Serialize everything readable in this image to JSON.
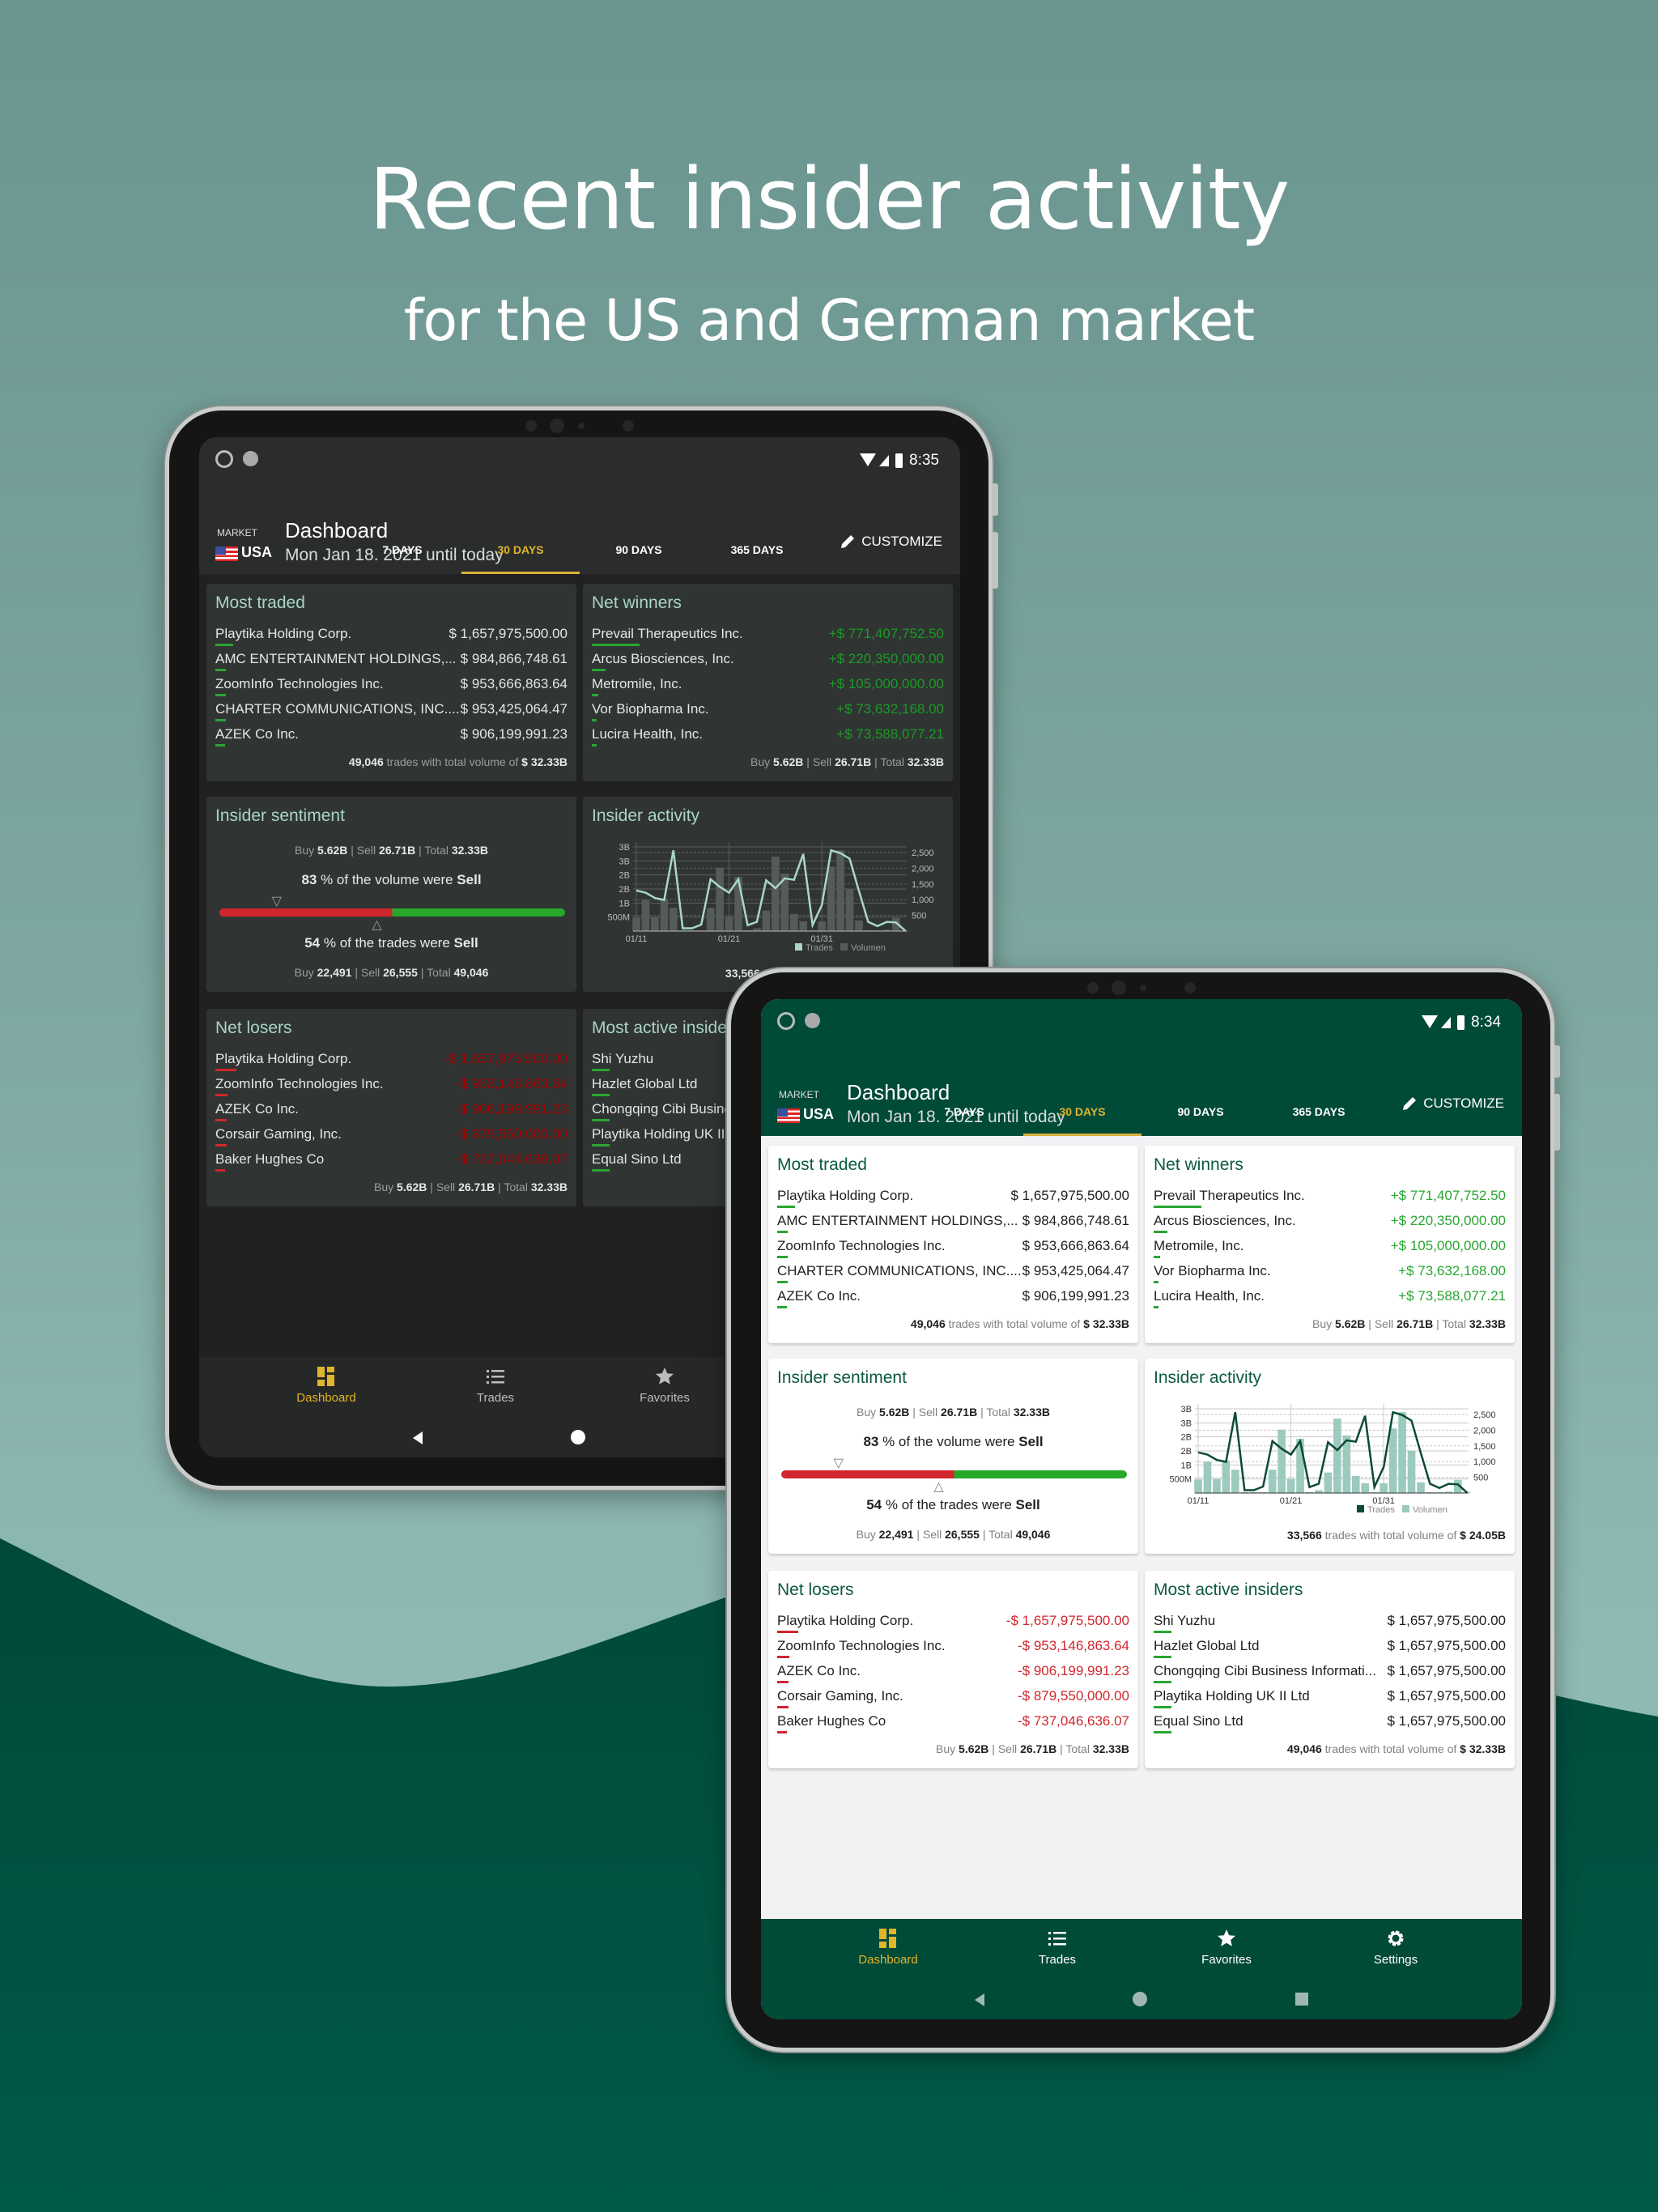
{
  "hero": {
    "title": "Recent insider activity",
    "subtitle": "for the US and German market"
  },
  "colors": {
    "accent_gold": "#e0b52c",
    "brand_green": "#004a38",
    "positive": "#2aa532",
    "negative": "#d0262d",
    "bar_volume": "#9ccabf",
    "line_trades": "#0b4a36"
  },
  "tablets": [
    {
      "theme": "dark",
      "time": "8:35"
    },
    {
      "theme": "light",
      "time": "8:34"
    }
  ],
  "dashboard": {
    "market_label": "MARKET",
    "market": "USA",
    "title": "Dashboard",
    "subtitle": "Mon Jan 18. 2021 until today",
    "customize": "CUSTOMIZE",
    "tabs": [
      {
        "label": "7 DAYS",
        "active": false
      },
      {
        "label": "30 DAYS",
        "active": true
      },
      {
        "label": "90 DAYS",
        "active": false
      },
      {
        "label": "365 DAYS",
        "active": false
      }
    ],
    "most_traded": {
      "title": "Most traded",
      "rows": [
        {
          "name": "Playtika Holding Corp.",
          "value": "$ 1,657,975,500.00"
        },
        {
          "name": "AMC ENTERTAINMENT HOLDINGS,...",
          "value": "$ 984,866,748.61"
        },
        {
          "name": "ZoomInfo Technologies Inc.",
          "value": "$ 953,666,863.64"
        },
        {
          "name": "CHARTER COMMUNICATIONS, INC....",
          "value": "$ 953,425,064.47"
        },
        {
          "name": "AZEK Co Inc.",
          "value": "$ 906,199,991.23"
        }
      ],
      "footer": [
        {
          "t": "49,046",
          "b": true
        },
        {
          "t": " trades with total volume of "
        },
        {
          "t": "$ 32.33B",
          "b": true
        }
      ]
    },
    "net_winners": {
      "title": "Net winners",
      "rows": [
        {
          "name": "Prevail Therapeutics Inc.",
          "value": "+$ 771,407,752.50"
        },
        {
          "name": "Arcus Biosciences, Inc.",
          "value": "+$ 220,350,000.00"
        },
        {
          "name": "Metromile, Inc.",
          "value": "+$ 105,000,000.00"
        },
        {
          "name": "Vor Biopharma Inc.",
          "value": "+$ 73,632,168.00"
        },
        {
          "name": "Lucira Health, Inc.",
          "value": "+$ 73,588,077.21"
        }
      ],
      "footer": [
        {
          "t": "Buy "
        },
        {
          "t": "5.62B",
          "b": true
        },
        {
          "t": " | Sell "
        },
        {
          "t": "26.71B",
          "b": true
        },
        {
          "t": " | Total "
        },
        {
          "t": "32.33B",
          "b": true
        }
      ]
    },
    "insider_sentiment": {
      "title": "Insider sentiment",
      "volume_line": [
        {
          "t": "Buy "
        },
        {
          "t": "5.62B",
          "b": true
        },
        {
          "t": " | Sell "
        },
        {
          "t": "26.71B",
          "b": true
        },
        {
          "t": " | Total "
        },
        {
          "t": "32.33B",
          "b": true
        }
      ],
      "volume_sell_percent": 83,
      "volume_text": [
        {
          "t": "83",
          "b": true
        },
        {
          "t": " % of the volume were "
        },
        {
          "t": "Sell",
          "b": true
        }
      ],
      "trades_sell_percent": 54,
      "trades_text": [
        {
          "t": "54",
          "b": true
        },
        {
          "t": " % of the trades were "
        },
        {
          "t": "Sell",
          "b": true
        }
      ],
      "trades_line": [
        {
          "t": "Buy "
        },
        {
          "t": "22,491",
          "b": true
        },
        {
          "t": " | Sell "
        },
        {
          "t": "26,555",
          "b": true
        },
        {
          "t": " | Total "
        },
        {
          "t": "49,046",
          "b": true
        }
      ]
    },
    "insider_activity": {
      "title": "Insider activity",
      "footer": [
        {
          "t": "33,566",
          "b": true
        },
        {
          "t": " trades with total volume of "
        },
        {
          "t": "$ 24.05B",
          "b": true
        }
      ]
    },
    "net_losers": {
      "title": "Net losers",
      "rows": [
        {
          "name": "Playtika Holding Corp.",
          "value": "-$ 1,657,975,500.00"
        },
        {
          "name": "ZoomInfo Technologies Inc.",
          "value": "-$ 953,146,863.64"
        },
        {
          "name": "AZEK Co Inc.",
          "value": "-$ 906,199,991.23"
        },
        {
          "name": "Corsair Gaming, Inc.",
          "value": "-$ 879,550,000.00"
        },
        {
          "name": "Baker Hughes Co",
          "value": "-$ 737,046,636.07"
        }
      ],
      "footer": [
        {
          "t": "Buy "
        },
        {
          "t": "5.62B",
          "b": true
        },
        {
          "t": " | Sell "
        },
        {
          "t": "26.71B",
          "b": true
        },
        {
          "t": " | Total "
        },
        {
          "t": "32.33B",
          "b": true
        }
      ]
    },
    "most_active_insiders": {
      "title": "Most active insiders",
      "rows": [
        {
          "name": "Shi Yuzhu",
          "value": "$ 1,657,975,500.00"
        },
        {
          "name": "Hazlet Global Ltd",
          "value": "$ 1,657,975,500.00"
        },
        {
          "name": "Chongqing Cibi Business Informati...",
          "value": "$ 1,657,975,500.00"
        },
        {
          "name": "Playtika Holding UK II Ltd",
          "value": "$ 1,657,975,500.00"
        },
        {
          "name": "Equal Sino Ltd",
          "value": "$ 1,657,975,500.00"
        }
      ],
      "footer": [
        {
          "t": "49,046",
          "b": true
        },
        {
          "t": " trades with total volume of "
        },
        {
          "t": "$ 32.33B",
          "b": true
        }
      ]
    },
    "nav": [
      {
        "label": "Dashboard",
        "icon": "dashboard-icon",
        "active": true
      },
      {
        "label": "Trades",
        "icon": "list-icon",
        "active": false
      },
      {
        "label": "Favorites",
        "icon": "star-icon",
        "active": false
      },
      {
        "label": "Settings",
        "icon": "gear-icon",
        "active": false
      }
    ]
  },
  "chart_data": {
    "type": "bar-line",
    "x": [
      "01/11",
      "01/12",
      "01/13",
      "01/14",
      "01/15",
      "01/16",
      "01/17",
      "01/18",
      "01/19",
      "01/20",
      "01/21",
      "01/22",
      "01/23",
      "01/24",
      "01/25",
      "01/26",
      "01/27",
      "01/28",
      "01/29",
      "01/30",
      "01/31",
      "02/01",
      "02/02",
      "02/03",
      "02/04",
      "02/05",
      "02/06",
      "02/07",
      "02/08",
      "02/09"
    ],
    "x_tick_labels": [
      "01/11",
      "01/21",
      "01/31"
    ],
    "series": [
      {
        "name": "Volumen",
        "type": "bar",
        "axis": "left",
        "values": [
          0.48,
          1.12,
          0.5,
          1.16,
          0.83,
          0.03,
          0.03,
          0.03,
          0.83,
          2.26,
          0.5,
          1.93,
          0.03,
          0.1,
          0.73,
          2.65,
          2.05,
          0.61,
          0.35,
          0.03,
          0.35,
          2.3,
          2.88,
          1.51,
          0.38,
          0.03,
          0.03,
          0.05,
          0.47,
          0.02
        ]
      },
      {
        "name": "Trades",
        "type": "line",
        "axis": "right",
        "values": [
          1295,
          1223,
          1054,
          991,
          2571,
          89,
          89,
          205,
          1652,
          1411,
          1223,
          1652,
          188,
          295,
          1616,
          1366,
          1679,
          1634,
          2455,
          188,
          830,
          2571,
          2482,
          2304,
          1277,
          295,
          161,
          295,
          277,
          9
        ]
      }
    ],
    "left_axis": {
      "range": [
        0,
        3
      ],
      "ticks": [
        {
          "v": 3,
          "label": "3B"
        },
        {
          "v": 2.5,
          "label": "3B"
        },
        {
          "v": 2,
          "label": "2B"
        },
        {
          "v": 1.5,
          "label": "2B"
        },
        {
          "v": 1,
          "label": "1B"
        },
        {
          "v": 0.5,
          "label": "500M"
        }
      ]
    },
    "right_axis": {
      "range": [
        0,
        2500
      ],
      "ticks": [
        {
          "v": 2500,
          "label": "2,500"
        },
        {
          "v": 2000,
          "label": "2,000"
        },
        {
          "v": 1500,
          "label": "1,500"
        },
        {
          "v": 1000,
          "label": "1,000"
        },
        {
          "v": 500,
          "label": "500"
        }
      ]
    },
    "legend": {
      "placement": "bottom-right",
      "entries": [
        "Trades",
        "Volumen"
      ]
    },
    "grid": true
  }
}
